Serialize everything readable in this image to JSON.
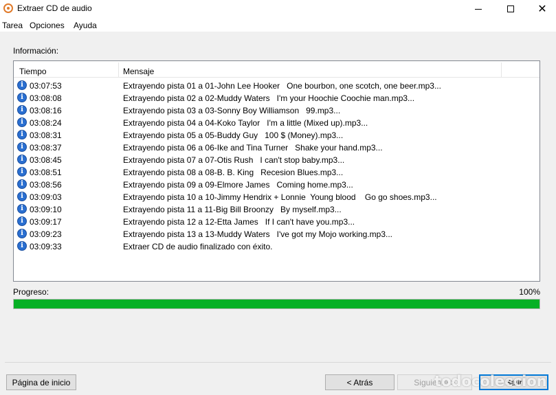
{
  "window": {
    "title": "Extraer CD de audio",
    "close_glyph": "✕"
  },
  "menu": {
    "items": [
      "Tarea",
      "Opciones",
      "Ayuda"
    ]
  },
  "info_label": "Información:",
  "log": {
    "columns": [
      "Tiempo",
      "Mensaje"
    ],
    "icon_glyph": "i",
    "rows": [
      {
        "time": "03:07:53",
        "message": "Extrayendo pista 01 a 01-John Lee Hooker   One bourbon, one scotch, one beer.mp3..."
      },
      {
        "time": "03:08:08",
        "message": "Extrayendo pista 02 a 02-Muddy Waters   I'm your Hoochie Coochie man.mp3..."
      },
      {
        "time": "03:08:16",
        "message": "Extrayendo pista 03 a 03-Sonny Boy Williamson   99.mp3..."
      },
      {
        "time": "03:08:24",
        "message": "Extrayendo pista 04 a 04-Koko Taylor   I'm a little (Mixed up).mp3..."
      },
      {
        "time": "03:08:31",
        "message": "Extrayendo pista 05 a 05-Buddy Guy   100 $ (Money).mp3..."
      },
      {
        "time": "03:08:37",
        "message": "Extrayendo pista 06 a 06-Ike and Tina Turner   Shake your hand.mp3..."
      },
      {
        "time": "03:08:45",
        "message": "Extrayendo pista 07 a 07-Otis Rush   I can't stop baby.mp3..."
      },
      {
        "time": "03:08:51",
        "message": "Extrayendo pista 08 a 08-B. B. King   Recesion Blues.mp3..."
      },
      {
        "time": "03:08:56",
        "message": "Extrayendo pista 09 a 09-Elmore James   Coming home.mp3..."
      },
      {
        "time": "03:09:03",
        "message": "Extrayendo pista 10 a 10-Jimmy Hendrix + Lonnie  Young blood    Go go shoes.mp3..."
      },
      {
        "time": "03:09:10",
        "message": "Extrayendo pista 11 a 11-Big Bill Broonzy   By myself.mp3..."
      },
      {
        "time": "03:09:17",
        "message": "Extrayendo pista 12 a 12-Etta James   If I can't have you.mp3..."
      },
      {
        "time": "03:09:23",
        "message": "Extrayendo pista 13 a 13-Muddy Waters   I've got my Mojo working.mp3..."
      },
      {
        "time": "03:09:33",
        "message": "Extraer CD de audio finalizado con éxito."
      }
    ]
  },
  "progress": {
    "label": "Progreso:",
    "value_text": "100%",
    "fraction": 1.0,
    "color": "#06b025"
  },
  "buttons": {
    "home": "Página de inicio",
    "back": "< Atrás",
    "next": "Siguiente >",
    "exit": "Salir"
  },
  "watermark": "todocoleccion",
  "colors": {
    "accent": "#0078d7",
    "info_icon": "#2a6fd1"
  }
}
